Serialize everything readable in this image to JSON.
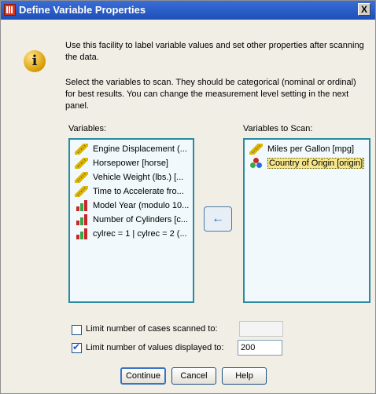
{
  "window": {
    "title": "Define Variable Properties",
    "close_glyph": "X"
  },
  "info": {
    "icon": "info-icon",
    "paragraph1": "Use this facility to label variable values and set other properties after scanning the data.",
    "paragraph2": "Select the variables to scan. They should be categorical (nominal or ordinal) for best results. You can change the measurement level setting in the next panel."
  },
  "variables": {
    "label": "Variables:",
    "items": [
      {
        "label": "Engine Displacement (...",
        "icon": "scale-icon"
      },
      {
        "label": "Horsepower [horse]",
        "icon": "scale-icon"
      },
      {
        "label": "Vehicle Weight (lbs.) [...",
        "icon": "scale-icon"
      },
      {
        "label": "Time to Accelerate fro...",
        "icon": "scale-icon"
      },
      {
        "label": "Model Year (modulo 10...",
        "icon": "ordinal-icon"
      },
      {
        "label": "Number of Cylinders [c...",
        "icon": "ordinal-icon"
      },
      {
        "label": "cylrec = 1 | cylrec = 2 (...",
        "icon": "ordinal-icon"
      }
    ]
  },
  "scan": {
    "label": "Variables to Scan:",
    "items": [
      {
        "label": "Miles per Gallon [mpg]",
        "icon": "scale-icon"
      },
      {
        "label": "Country of Origin [origin]",
        "icon": "nominal-icon",
        "selected": true
      }
    ]
  },
  "options": {
    "limit_cases_label": "Limit number of cases scanned to:",
    "limit_cases_checked": false,
    "limit_cases_value": "",
    "limit_values_label": "Limit number of values displayed to:",
    "limit_values_checked": true,
    "limit_values_value": "200"
  },
  "buttons": {
    "continue": "Continue",
    "cancel": "Cancel",
    "help": "Help"
  },
  "colors": {
    "title_bar": "#1c4fb8",
    "listbox_border": "#2a8aa0",
    "listbox_bg": "#f1f9fc",
    "dialog_bg": "#f0eee5"
  }
}
